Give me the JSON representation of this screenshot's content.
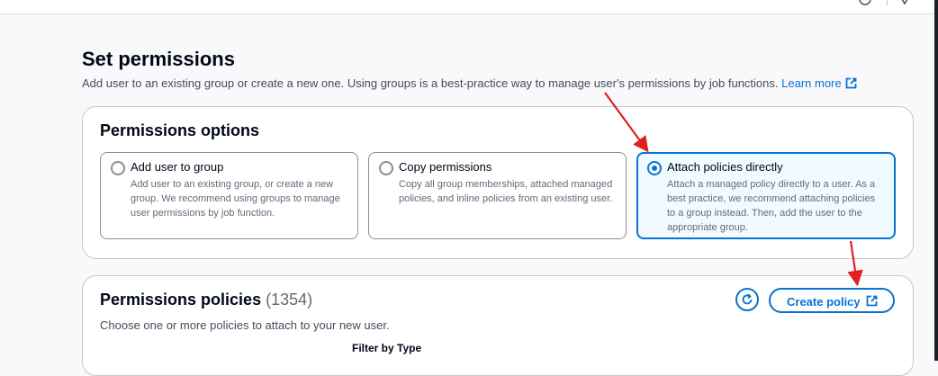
{
  "page": {
    "title": "Set permissions",
    "description": "Add user to an existing group or create a new one. Using groups is a best-practice way to manage user's permissions by job functions.",
    "learn_more": "Learn more"
  },
  "permissions_options": {
    "title": "Permissions options",
    "tiles": [
      {
        "label": "Add user to group",
        "description": "Add user to an existing group, or create a new group. We recommend using groups to manage user permissions by job function.",
        "selected": false
      },
      {
        "label": "Copy permissions",
        "description": "Copy all group memberships, attached managed policies, and inline policies from an existing user.",
        "selected": false
      },
      {
        "label": "Attach policies directly",
        "description": "Attach a managed policy directly to a user. As a best practice, we recommend attaching policies to a group instead. Then, add the user to the appropriate group.",
        "selected": true
      }
    ]
  },
  "permissions_policies": {
    "title": "Permissions policies",
    "count": "(1354)",
    "description": "Choose one or more policies to attach to your new user.",
    "create_button": "Create policy",
    "filter_label": "Filter by Type"
  },
  "colors": {
    "accent": "#0972d3",
    "annotation_arrow": "#e02020"
  }
}
